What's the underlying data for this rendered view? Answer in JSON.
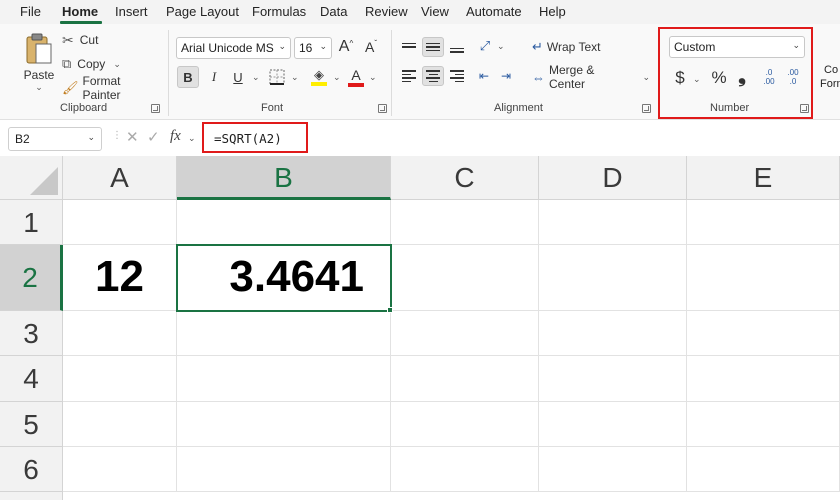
{
  "menu": {
    "tabs": [
      "File",
      "Home",
      "Insert",
      "Page Layout",
      "Formulas",
      "Data",
      "Review",
      "View",
      "Automate",
      "Help"
    ],
    "active_tab": "Home"
  },
  "ribbon": {
    "clipboard": {
      "paste_label": "Paste",
      "cut_label": "Cut",
      "copy_label": "Copy",
      "format_painter_label": "Format Painter",
      "group_label": "Clipboard"
    },
    "font": {
      "font_name": "Arial Unicode MS",
      "font_size": "16",
      "bold": "B",
      "italic": "I",
      "underline": "U",
      "grow": "A",
      "shrink": "A",
      "font_color_letter": "A",
      "group_label": "Font",
      "font_color": "#e01a1a",
      "highlight_color": "#ffee00"
    },
    "alignment": {
      "wrap_text_label": "Wrap Text",
      "merge_center_label": "Merge & Center",
      "group_label": "Alignment"
    },
    "number": {
      "format": "Custom",
      "currency_symbol": "$",
      "percent_symbol": "%",
      "comma_symbol": "❟",
      "increase_decimal_top": ".0",
      "increase_decimal_bottom": ".00",
      "decrease_decimal_top": ".00",
      "decrease_decimal_bottom": ".0",
      "group_label": "Number"
    },
    "styles": {
      "conditional_formatting_label_part1": "Co",
      "conditional_formatting_label_part2": "Form"
    }
  },
  "formula_bar": {
    "name_box": "B2",
    "fx_label": "fx",
    "formula": "=SQRT(A2)"
  },
  "grid": {
    "columns": [
      "A",
      "B",
      "C",
      "D",
      "E"
    ],
    "rows": [
      "1",
      "2",
      "3",
      "4",
      "5",
      "6"
    ],
    "selected_cell": "B2",
    "cells": {
      "A2": "12",
      "B2": "3.4641"
    }
  },
  "colors": {
    "accent_green": "#1a7343",
    "highlight_red": "#e01a1a"
  }
}
